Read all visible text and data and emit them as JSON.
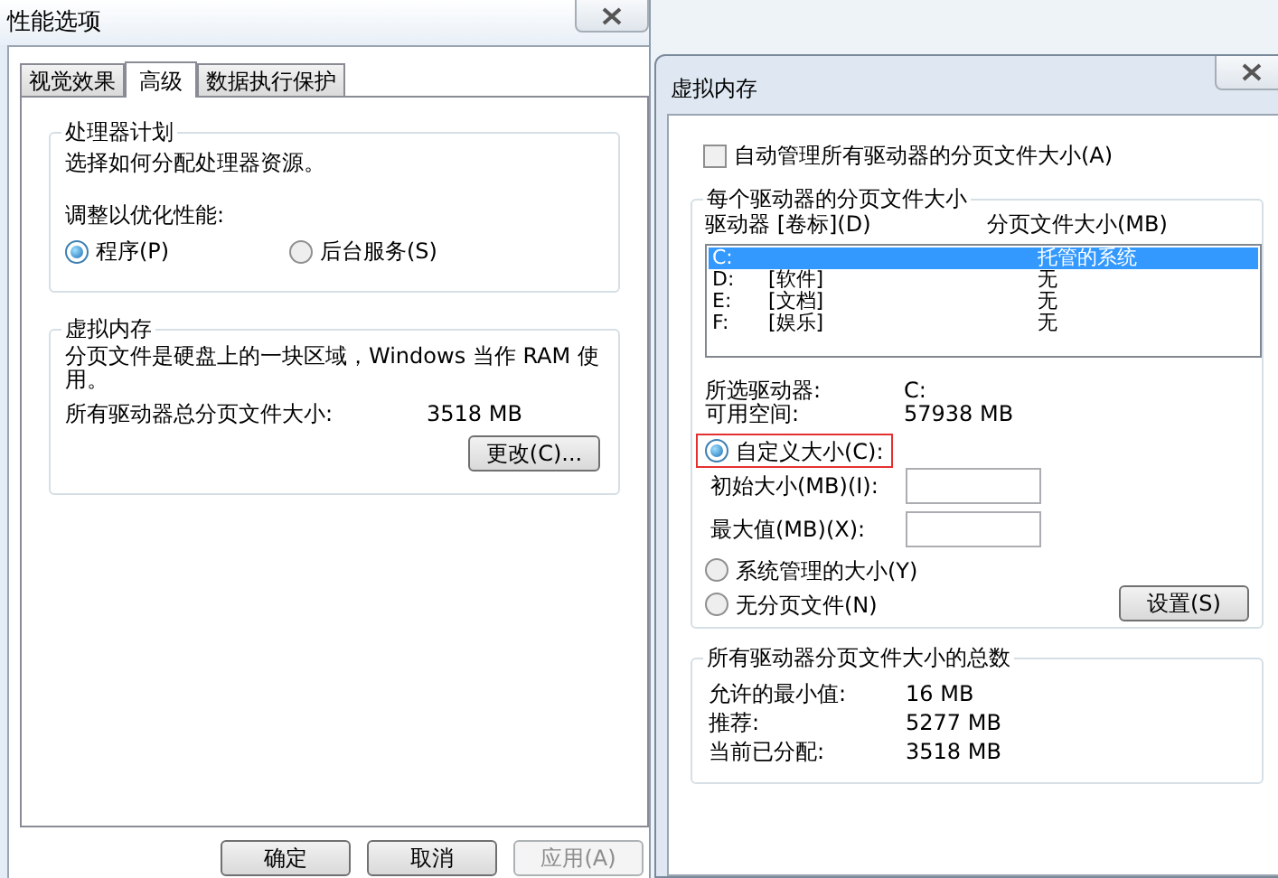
{
  "main_window": {
    "title": "性能选项",
    "tabs": [
      {
        "label": "视觉效果",
        "selected": false
      },
      {
        "label": "高级",
        "selected": true
      },
      {
        "label": "数据执行保护",
        "selected": false
      }
    ],
    "processor_group": {
      "title": "处理器计划",
      "description": "选择如何分配处理器资源。",
      "prompt": "调整以优化性能:",
      "options": [
        {
          "label": "程序(P)",
          "selected": true
        },
        {
          "label": "后台服务(S)",
          "selected": false
        }
      ]
    },
    "memory_group": {
      "title": "虚拟内存",
      "description": "分页文件是硬盘上的一块区域，Windows 当作 RAM 使用。",
      "total_label": "所有驱动器总分页文件大小:",
      "total_value": "3518 MB",
      "change_button": "更改(C)..."
    },
    "buttons": [
      {
        "label": "确定",
        "disabled": false
      },
      {
        "label": "取消",
        "disabled": false
      },
      {
        "label": "应用(A)",
        "disabled": true
      }
    ]
  },
  "dialog": {
    "title": "虚拟内存",
    "auto_manage": {
      "label": "自动管理所有驱动器的分页文件大小(A)",
      "checked": false
    },
    "per_drive": {
      "title": "每个驱动器的分页文件大小",
      "columns": [
        "驱动器 [卷标](D)",
        "分页文件大小(MB)"
      ],
      "rows": [
        {
          "drive": "C:",
          "size": "托管的系统",
          "selected": true
        },
        {
          "drive": "D:",
          "label": "[软件]",
          "size": "无",
          "selected": false
        },
        {
          "drive": "E:",
          "label": "[文档]",
          "size": "无",
          "selected": false
        },
        {
          "drive": "F:",
          "label": "[娱乐]",
          "size": "无",
          "selected": false
        }
      ],
      "info": [
        {
          "label": "所选驱动器:",
          "value": "C:"
        },
        {
          "label": "可用空间:",
          "value": "57938 MB"
        }
      ],
      "size_options": [
        {
          "label": "自定义大小(C):",
          "selected": true,
          "highlighted": true
        },
        {
          "label": "系统管理的大小(Y)",
          "selected": false,
          "highlighted": false
        },
        {
          "label": "无分页文件(N)",
          "selected": false,
          "highlighted": false
        }
      ],
      "fields": [
        {
          "label": "初始大小(MB)(I):"
        },
        {
          "label": "最大值(MB)(X):"
        }
      ],
      "set_button": "设置(S)"
    },
    "totals": {
      "title": "所有驱动器分页文件大小的总数",
      "rows": [
        {
          "label": "允许的最小值:",
          "value": "16 MB"
        },
        {
          "label": "推荐:",
          "value": "5277 MB"
        },
        {
          "label": "当前已分配:",
          "value": "3518 MB"
        }
      ]
    }
  }
}
